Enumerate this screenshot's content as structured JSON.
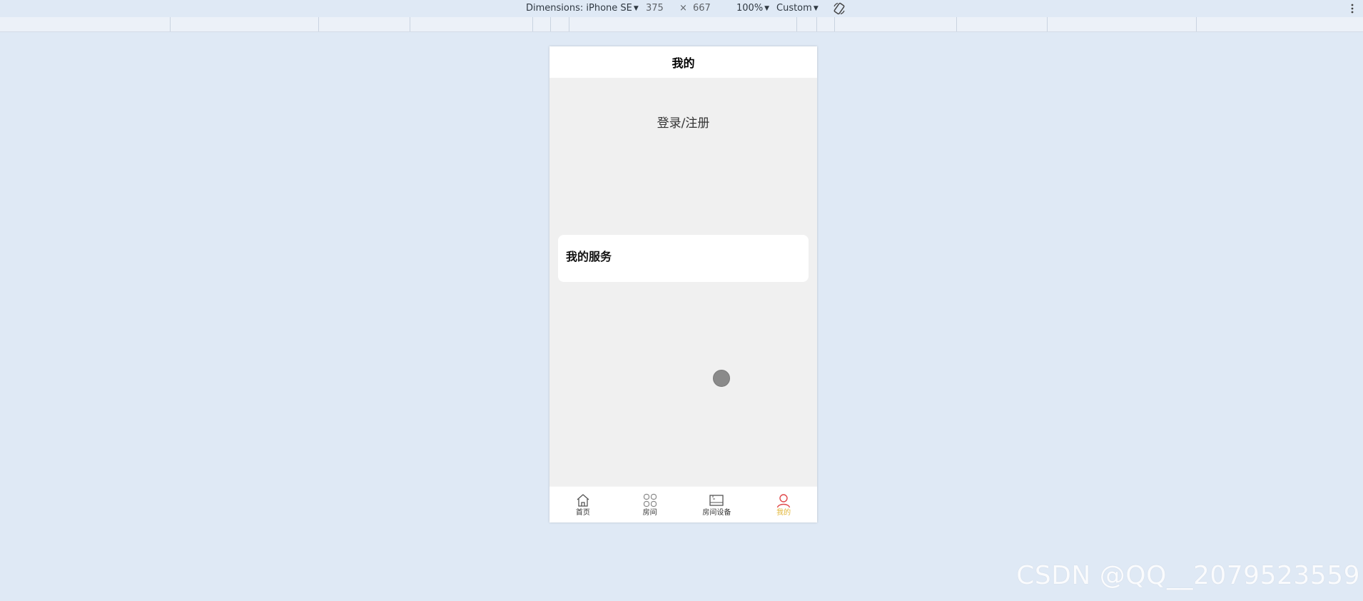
{
  "devtools": {
    "dimensions_label": "Dimensions: iPhone SE",
    "width_value": "375",
    "times_sign": "×",
    "height_value": "667",
    "zoom": "100%",
    "throttle": "Custom",
    "caret": "▼",
    "rotate_icon": "rotate-icon",
    "more_icon": "kebab-icon"
  },
  "app": {
    "header_title": "我的",
    "login_text": "登录/注册",
    "service_title": "我的服务",
    "tabbar": {
      "active_color": "#e2b73a",
      "items": [
        {
          "label": "首页",
          "icon": "home-icon"
        },
        {
          "label": "房间",
          "icon": "grid-icon"
        },
        {
          "label": "房间设备",
          "icon": "device-icon"
        },
        {
          "label": "我的",
          "icon": "user-icon"
        }
      ]
    }
  },
  "watermark": "CSDN @QQ__2079523559"
}
